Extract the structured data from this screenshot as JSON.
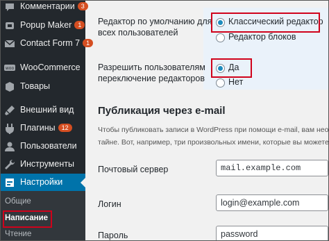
{
  "sidebar": {
    "items": [
      {
        "label": "Комментарии",
        "badge": "3",
        "icon": "comment-icon"
      },
      {
        "label": "Popup Maker",
        "badge": "1",
        "icon": "popup-icon"
      },
      {
        "label": "Contact Form 7",
        "badge": "1",
        "icon": "mail-icon"
      },
      {
        "label": "WooCommerce",
        "badge": "",
        "icon": "woo-icon"
      },
      {
        "label": "Товары",
        "badge": "",
        "icon": "products-icon"
      },
      {
        "label": "Внешний вид",
        "badge": "",
        "icon": "brush-icon"
      },
      {
        "label": "Плагины",
        "badge": "12",
        "icon": "plugin-icon"
      },
      {
        "label": "Пользователи",
        "badge": "",
        "icon": "users-icon"
      },
      {
        "label": "Инструменты",
        "badge": "",
        "icon": "tools-icon"
      },
      {
        "label": "Настройки",
        "badge": "",
        "icon": "settings-icon"
      }
    ],
    "submenu": [
      "Общие",
      "Написание",
      "Чтение"
    ]
  },
  "editor": {
    "label_line1": "Редактор по умолчанию для",
    "label_line2": "всех пользователей",
    "option1": "Классический редактор",
    "option2": "Редактор блоков",
    "selected": "Классический редактор"
  },
  "switch": {
    "label_line1": "Разрешить пользователям",
    "label_line2": "переключение редакторов",
    "option1": "Да",
    "option2": "Нет",
    "selected": "Да"
  },
  "email_section": {
    "title": "Публикация через e-mail",
    "desc_line1": "Чтобы публиковать записи в WordPress при помощи e-mail, вам необх",
    "desc_line2": "тайне. Вот, например, три произвольных имени, которые вы можете"
  },
  "fields": {
    "server_label": "Почтовый сервер",
    "server_value": "mail.example.com",
    "login_label": "Логин",
    "login_value": "login@example.com",
    "password_label": "Пароль",
    "password_value": "password"
  },
  "colors": {
    "sidebar_bg": "#23282d",
    "active_bg": "#0073aa",
    "badge": "#d54e21",
    "highlight": "#d0021b",
    "radio_dot": "#1e8cbe"
  }
}
